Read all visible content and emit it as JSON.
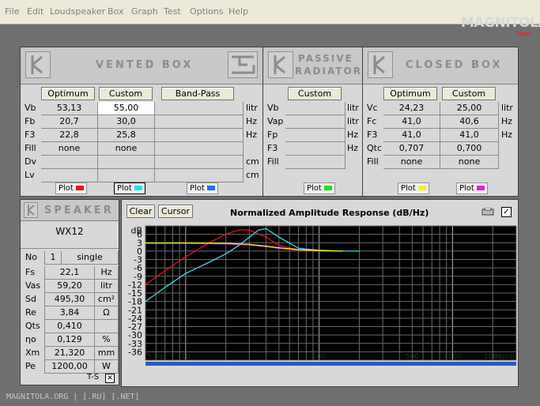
{
  "menu": [
    "File",
    "Edit",
    "Loudspeaker",
    "Box",
    "Graph",
    "Test",
    "Options",
    "Help"
  ],
  "logo": {
    "main": "MAGNITOLA",
    "sub": "Team"
  },
  "vented": {
    "title": "VENTED BOX",
    "cols": [
      "Optimum",
      "Custom",
      "Band-Pass"
    ],
    "rows": [
      {
        "label": "Vb",
        "opt": "53,13",
        "cust": "55,00",
        "bp": "",
        "unit": "litr"
      },
      {
        "label": "Fb",
        "opt": "20,7",
        "cust": "30,0",
        "bp": "",
        "unit": "Hz"
      },
      {
        "label": "F3",
        "opt": "22,8",
        "cust": "25,8",
        "bp": "",
        "unit": "Hz"
      },
      {
        "label": "Fill",
        "opt": "none",
        "cust": "none",
        "bp": "",
        "unit": ""
      },
      {
        "label": "Dv",
        "opt": "",
        "cust": "",
        "bp": "",
        "unit": "cm"
      },
      {
        "label": "Lv",
        "opt": "",
        "cust": "",
        "bp": "",
        "unit": "cm"
      }
    ],
    "plot_label": "Plot",
    "plot_colors": [
      "#e01818",
      "#20e0f0",
      "#2070f0"
    ]
  },
  "passive": {
    "title1": "PASSIVE",
    "title2": "RADIATOR",
    "col": "Custom",
    "rows": [
      {
        "label": "Vb",
        "val": "",
        "unit": "litr"
      },
      {
        "label": "Vap",
        "val": "",
        "unit": "litr"
      },
      {
        "label": "Fp",
        "val": "",
        "unit": "Hz"
      },
      {
        "label": "F3",
        "val": "",
        "unit": "Hz"
      },
      {
        "label": "Fill",
        "val": "",
        "unit": ""
      }
    ],
    "plot_label": "Plot",
    "plot_color": "#20e020"
  },
  "closed": {
    "title": "CLOSED BOX",
    "cols": [
      "Optimum",
      "Custom"
    ],
    "rows": [
      {
        "label": "Vc",
        "opt": "24,23",
        "cust": "25,00",
        "unit": "litr"
      },
      {
        "label": "Fc",
        "opt": "41,0",
        "cust": "40,6",
        "unit": "Hz"
      },
      {
        "label": "F3",
        "opt": "41,0",
        "cust": "41,0",
        "unit": "Hz"
      },
      {
        "label": "Qtc",
        "opt": "0,707",
        "cust": "0,700",
        "unit": ""
      },
      {
        "label": "Fill",
        "opt": "none",
        "cust": "none",
        "unit": ""
      }
    ],
    "plot_label": "Plot",
    "plot_colors": [
      "#f0f020",
      "#e020e0"
    ]
  },
  "speaker": {
    "title": "SPEAKER",
    "model": "WX12",
    "no_label": "No",
    "no_val": "1",
    "mode": "single",
    "rows": [
      {
        "label": "Fs",
        "val": "22,1",
        "unit": "Hz"
      },
      {
        "label": "Vas",
        "val": "59,20",
        "unit": "litr"
      },
      {
        "label": "Sd",
        "val": "495,30",
        "unit": "cm²"
      },
      {
        "label": "Re",
        "val": "3,84",
        "unit": "Ω"
      },
      {
        "label": "Qts",
        "val": "0,410",
        "unit": ""
      },
      {
        "label": "ηo",
        "val": "0,129",
        "unit": "%"
      },
      {
        "label": "Xm",
        "val": "21,320",
        "unit": "mm"
      },
      {
        "label": "Pe",
        "val": "1200,00",
        "unit": "W"
      }
    ],
    "ts_label": "T-S"
  },
  "graph": {
    "clear_label": "Clear",
    "cursor_label": "Cursor",
    "title": "Normalized Amplitude Response (dB/Hz)",
    "x_left": "5 Hz",
    "x_right": "Repsh"
  },
  "chart_data": {
    "type": "line",
    "title": "Normalized Amplitude Response (dB/Hz)",
    "ylabel": "dB",
    "ylim": [
      -39,
      9
    ],
    "xlim": [
      5,
      3000
    ],
    "xscale": "log",
    "yticks": [
      6,
      3,
      0,
      -3,
      -6,
      -9,
      -12,
      -15,
      -18,
      -21,
      -24,
      -27,
      -30,
      -33,
      -36
    ],
    "xticks": [
      10,
      100,
      500,
      1000,
      2000
    ],
    "series": [
      {
        "color": "#e01818",
        "x": [
          5,
          7,
          10,
          15,
          20,
          25,
          30,
          40,
          50,
          70,
          100,
          150
        ],
        "y": [
          -12,
          -7,
          -2,
          3,
          6,
          7.6,
          7.5,
          5,
          2,
          0.5,
          0,
          0
        ]
      },
      {
        "color": "#40d8e8",
        "x": [
          5,
          7,
          10,
          15,
          20,
          25,
          30,
          35,
          40,
          50,
          70,
          100,
          150,
          200
        ],
        "y": [
          -18,
          -13,
          -8,
          -4,
          -1,
          2,
          5,
          7.5,
          8,
          5,
          1,
          0.3,
          0,
          0
        ]
      },
      {
        "color": "#e020e0",
        "x": [
          5,
          10,
          20,
          30,
          40,
          50,
          70,
          100,
          150
        ],
        "y": [
          2.8,
          2.8,
          2.6,
          2.2,
          1.6,
          1,
          0.4,
          0.1,
          0
        ]
      },
      {
        "color": "#f0f020",
        "x": [
          5,
          10,
          20,
          30,
          40,
          50,
          70,
          100,
          150
        ],
        "y": [
          2.9,
          2.9,
          2.8,
          2.4,
          1.8,
          1.2,
          0.5,
          0.2,
          0
        ]
      }
    ]
  },
  "status": "MAGNITOLA.ORG | [.RU] [.NET]"
}
